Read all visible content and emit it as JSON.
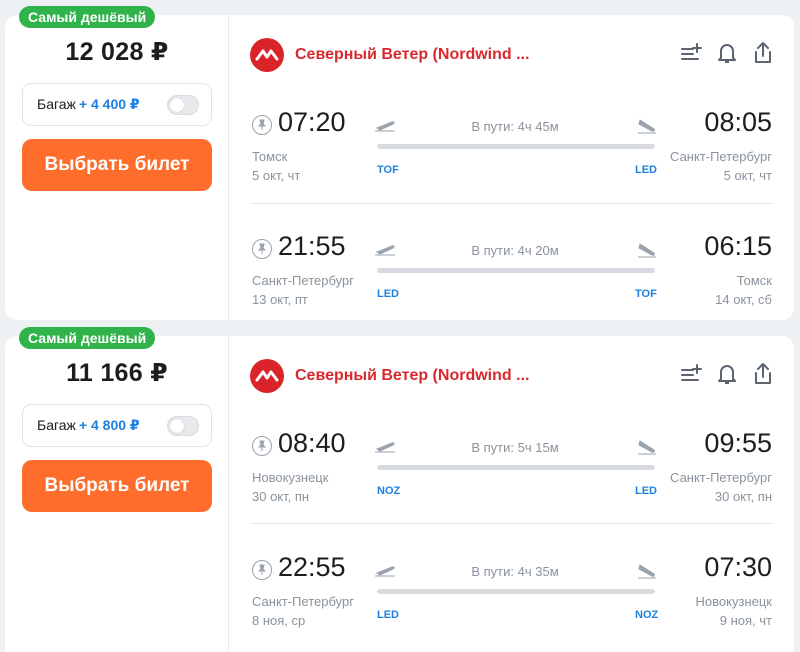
{
  "colors": {
    "accent_green": "#2fb34a",
    "buy_orange": "#ff6d2c",
    "airline_red": "#d72a2f",
    "link_blue": "#1d80e0"
  },
  "icons": [
    "add-to-list-icon",
    "bell-icon",
    "share-icon",
    "pin-icon",
    "takeoff-icon",
    "landing-icon",
    "airline-logo-icon"
  ],
  "offers": [
    {
      "badge": "Самый дешёвый",
      "price": "12 028 ₽",
      "baggage_label": "Багаж",
      "baggage_price": "+ 4 400 ₽",
      "buy_label": "Выбрать билет",
      "airline": "Северный Ветер (Nordwind ...",
      "segments": [
        {
          "dep_time": "07:20",
          "dep_city": "Томск",
          "dep_date": "5 окт, чт",
          "dep_code": "TOF",
          "duration": "В пути: 4ч 45м",
          "arr_time": "08:05",
          "arr_city": "Санкт-Петербург",
          "arr_date": "5 окт, чт",
          "arr_code": "LED"
        },
        {
          "dep_time": "21:55",
          "dep_city": "Санкт-Петербург",
          "dep_date": "13 окт, пт",
          "dep_code": "LED",
          "duration": "В пути: 4ч 20м",
          "arr_time": "06:15",
          "arr_city": "Томск",
          "arr_date": "14 окт, сб",
          "arr_code": "TOF"
        }
      ]
    },
    {
      "badge": "Самый дешёвый",
      "price": "11 166 ₽",
      "baggage_label": "Багаж",
      "baggage_price": "+ 4 800 ₽",
      "buy_label": "Выбрать билет",
      "airline": "Северный Ветер (Nordwind ...",
      "segments": [
        {
          "dep_time": "08:40",
          "dep_city": "Новокузнецк",
          "dep_date": "30 окт, пн",
          "dep_code": "NOZ",
          "duration": "В пути: 5ч 15м",
          "arr_time": "09:55",
          "arr_city": "Санкт-Петербург",
          "arr_date": "30 окт, пн",
          "arr_code": "LED"
        },
        {
          "dep_time": "22:55",
          "dep_city": "Санкт-Петербург",
          "dep_date": "8 ноя, ср",
          "dep_code": "LED",
          "duration": "В пути: 4ч 35м",
          "arr_time": "07:30",
          "arr_city": "Новокузнецк",
          "arr_date": "9 ноя, чт",
          "arr_code": "NOZ"
        }
      ]
    }
  ]
}
